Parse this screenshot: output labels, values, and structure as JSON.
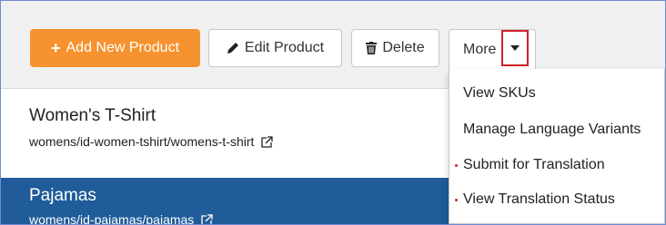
{
  "toolbar": {
    "add_label": "Add New Product",
    "edit_label": "Edit Product",
    "delete_label": "Delete",
    "more_label": "More"
  },
  "more_menu": {
    "items": [
      {
        "label": "View SKUs",
        "marked": false
      },
      {
        "label": "Manage Language Variants",
        "marked": false
      },
      {
        "label": "Submit for Translation",
        "marked": true
      },
      {
        "label": "View Translation Status",
        "marked": true
      }
    ]
  },
  "products": [
    {
      "title": "Women's T-Shirt",
      "path": "womens/id-women-tshirt/womens-t-shirt",
      "selected": false
    },
    {
      "title": "Pajamas",
      "path": "womens/id-pajamas/pajamas",
      "selected": true
    }
  ],
  "colors": {
    "add_button": "#f6922f",
    "selected_row": "#1f5c99",
    "highlight": "#d0202a"
  }
}
